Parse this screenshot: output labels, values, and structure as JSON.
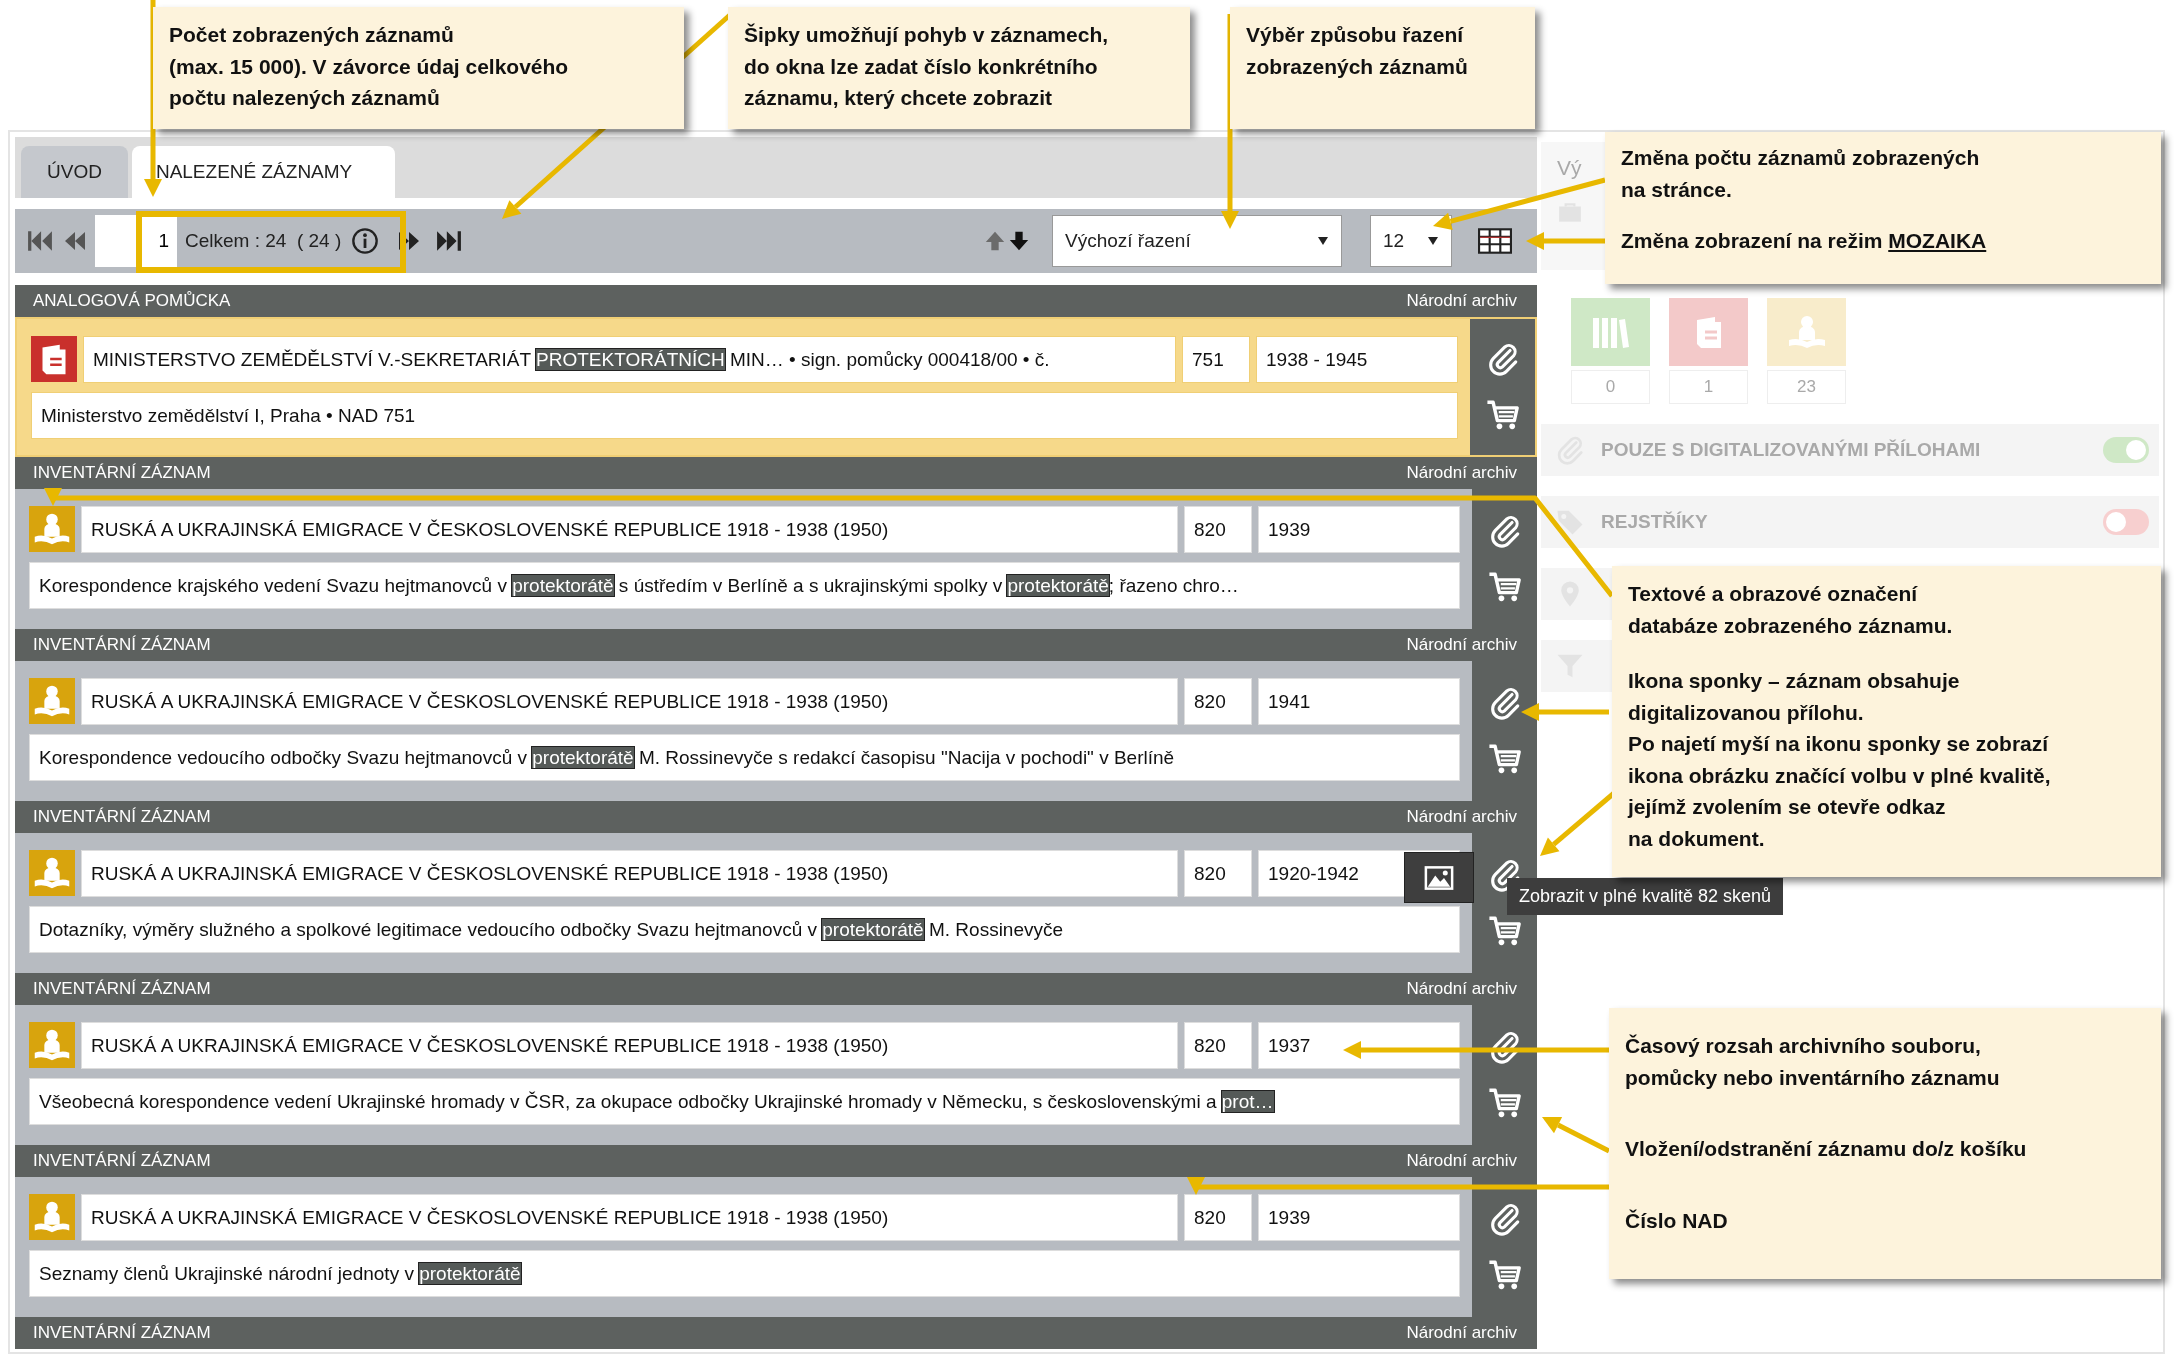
{
  "tabs": [
    {
      "label": "ÚVOD",
      "selected": false
    },
    {
      "label": "NALEZENÉ ZÁZNAMY",
      "selected": true
    }
  ],
  "pager": {
    "page": "1",
    "total": "Celkem : 24  ( 24 )"
  },
  "sort": {
    "value": "Výchozí řazení"
  },
  "page_size": {
    "value": "12"
  },
  "records": [
    {
      "type": "ANALOGOVÁ POMŮCKA",
      "archive": "Národní archiv",
      "kind": "aid",
      "selected": true,
      "title": "MINISTERSTVO ZEMĚDĚLSTVÍ V.-SEKRETARIÁT **PROTEKTORÁTNÍCH** MIN… • sign. pomůcky 000418/00 • č.",
      "nad": "751",
      "dates": "1938 - 1945",
      "description": "Ministerstvo zemědělství I, Praha • NAD 751"
    },
    {
      "type": "INVENTÁRNÍ ZÁZNAM",
      "archive": "Národní archiv",
      "kind": "inventory",
      "selected": false,
      "title": "RUSKÁ A UKRAJINSKÁ EMIGRACE V ČESKOSLOVENSKÉ REPUBLICE 1918 - 1938 (1950)",
      "nad": "820",
      "dates": "1939",
      "description": "Korespondence krajského vedení Svazu hejtmanovců v **protektorátě** s ústředím v Berlíně a s ukrajinskými spolky v **protektorátě**; řazeno chro…"
    },
    {
      "type": "INVENTÁRNÍ ZÁZNAM",
      "archive": "Národní archiv",
      "kind": "inventory",
      "selected": false,
      "title": "RUSKÁ A UKRAJINSKÁ EMIGRACE V ČESKOSLOVENSKÉ REPUBLICE 1918 - 1938 (1950)",
      "nad": "820",
      "dates": "1941",
      "description": "Korespondence vedoucího odbočky Svazu hejtmanovců v **protektorátě** M. Rossinevyče s redakcí časopisu \"Nacija v pochodi\" v Berlíně"
    },
    {
      "type": "INVENTÁRNÍ ZÁZNAM",
      "archive": "Národní archiv",
      "kind": "inventory",
      "selected": false,
      "title": "RUSKÁ A UKRAJINSKÁ EMIGRACE V ČESKOSLOVENSKÉ REPUBLICE 1918 - 1938 (1950)",
      "nad": "820",
      "dates": "1920-1942",
      "description": "Dotazníky, výměry služného a spolkové legitimace vedoucího odbočky Svazu hejtmanovců v **protektorátě** M. Rossinevyče",
      "image_button": true,
      "tooltip": "Zobrazit v plné kvalitě 82 skenů"
    },
    {
      "type": "INVENTÁRNÍ ZÁZNAM",
      "archive": "Národní archiv",
      "kind": "inventory",
      "selected": false,
      "title": "RUSKÁ A UKRAJINSKÁ EMIGRACE V ČESKOSLOVENSKÉ REPUBLICE 1918 - 1938 (1950)",
      "nad": "820",
      "dates": "1937",
      "description": "Všeobecná korespondence vedení Ukrajinské hromady v ČSR, za okupace odbočky Ukrajinské hromady v Německu, s československými a **prot…**"
    },
    {
      "type": "INVENTÁRNÍ ZÁZNAM",
      "archive": "Národní archiv",
      "kind": "inventory",
      "selected": false,
      "title": "RUSKÁ A UKRAJINSKÁ EMIGRACE V ČESKOSLOVENSKÉ REPUBLICE 1918 - 1938 (1950)",
      "nad": "820",
      "dates": "1939",
      "description": "Seznamy členů Ukrajinské národní jednoty v **protektorátě**"
    }
  ],
  "trailing_header": {
    "type": "INVENTÁRNÍ ZÁZNAM",
    "archive": "Národní archiv"
  },
  "sidebar": {
    "heading": "Vý",
    "tiles": [
      {
        "kind": "fonds",
        "color": "#cfe8c6",
        "count": "0"
      },
      {
        "kind": "aid",
        "color": "#f3c9c9",
        "count": "1"
      },
      {
        "kind": "inventory",
        "color": "#f8eccb",
        "count": "23"
      }
    ],
    "filters": [
      {
        "kind": "attachment",
        "label": "POUZE S DIGITALIZOVANÝMI PŘÍLOHAMI",
        "on": true
      },
      {
        "kind": "tag",
        "label": "REJSTŘÍKY",
        "on": false
      }
    ]
  },
  "callouts": [
    {
      "paragraphs": [
        "Počet zobrazených záznamů\n(max. 15 000). V závorce údaj celkového\npočtu nalezených záznamů"
      ]
    },
    {
      "paragraphs": [
        "Šipky umožňují pohyb v záznamech,\ndo okna lze zadat číslo konkrétního\nzáznamu, který chcete zobrazit"
      ]
    },
    {
      "paragraphs": [
        "Výběr způsobu řazení\nzobrazených záznamů"
      ]
    },
    {
      "paragraphs": [
        "Změna počtu záznamů zobrazených\n na stránce.",
        "Změna zobrazení na režim *MOZAIKA*"
      ]
    },
    {
      "paragraphs": [
        "Textové a obrazové označení\ndatabáze zobrazeného záznamu.",
        "Ikona sponky – záznam obsahuje\ndigitalizovanou přílohu.\nPo najetí myší na ikonu sponky se zobrazí\nikona obrázku značící volbu v plné kvalitě,\njejímž zvolením se otevře odkaz\nna dokument."
      ]
    },
    {
      "paragraphs": [
        "Časový rozsah archivního souboru,\npomůcky nebo inventárního záznamu",
        "Vložení/odstranění záznamu do/z košíku",
        "Číslo NAD"
      ]
    }
  ]
}
